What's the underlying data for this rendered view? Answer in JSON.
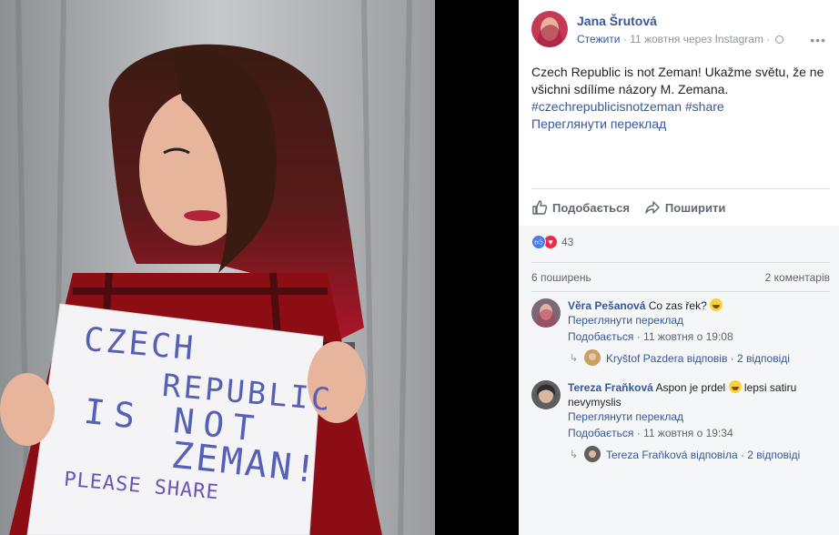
{
  "post": {
    "author": "Jana Šrutová",
    "follow": "Стежити",
    "time_source": "11 жовтня через Instagram",
    "text": "Czech Republic is not Zeman! Ukažme světu, že ne všichni sdílíme názory M. Zemana.",
    "hashtags": "#czechrepublicisnotzeman #share",
    "translate": "Переглянути переклад"
  },
  "photo_sign": {
    "line1": "CZECH",
    "line2": "REPUBLIC",
    "line3": "IS NOT",
    "line4": "ZEMAN!",
    "line5": "PLEASE SHARE"
  },
  "actions": {
    "like": "Подобається",
    "share": "Поширити"
  },
  "reactions": {
    "count": "43"
  },
  "stats": {
    "shares": "6 поширень",
    "comments": "2 коментарів"
  },
  "comments": [
    {
      "name": "Věra Pešanová",
      "text": "Co zas řek?",
      "translate": "Переглянути переклад",
      "like": "Подобається",
      "time": "11 жовтня о 19:08",
      "reply_summary": "Kryštof Pazdera відповів · 2 відповіді"
    },
    {
      "name": "Tereza Fraňková",
      "text_before": "Aspon je prdel",
      "text_after": "lepsi satiru nevymyslis",
      "translate": "Переглянути переклад",
      "like": "Подобається",
      "time": "11 жовтня о 19:34",
      "reply_summary": "Tereza Fraňková відповіла · 2 відповіді"
    }
  ],
  "colors": {
    "link": "#365899",
    "muted": "#90949c",
    "panel_bg": "#ffffff",
    "comments_bg": "#f5f6f7"
  },
  "icons": [
    "globe-icon",
    "more-icon",
    "thumbs-up-icon",
    "share-arrow-icon",
    "like-reaction-icon",
    "love-reaction-icon",
    "smile-emoji-icon"
  ]
}
